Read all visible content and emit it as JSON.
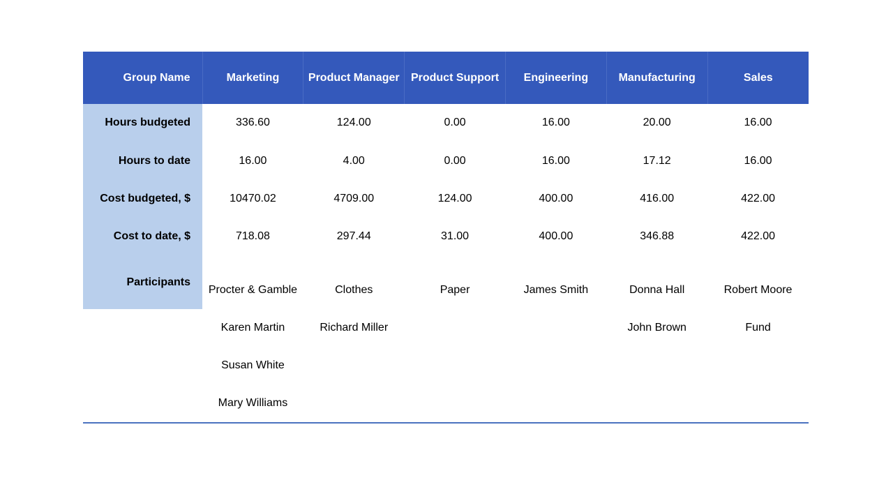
{
  "table": {
    "header": {
      "label": "Group Name",
      "columns": [
        "Marketing",
        "Product Manager",
        "Product Support",
        "Engineering",
        "Manufacturing",
        "Sales"
      ]
    },
    "rows": [
      {
        "label": "Hours budgeted",
        "values": [
          "336.60",
          "124.00",
          "0.00",
          "16.00",
          "20.00",
          "16.00"
        ]
      },
      {
        "label": "Hours to date",
        "values": [
          "16.00",
          "4.00",
          "0.00",
          "16.00",
          "17.12",
          "16.00"
        ]
      },
      {
        "label": "Cost budgeted, $",
        "values": [
          "10470.02",
          "4709.00",
          "124.00",
          "400.00",
          "416.00",
          "422.00"
        ]
      },
      {
        "label": "Cost to date, $",
        "values": [
          "718.08",
          "297.44",
          "31.00",
          "400.00",
          "346.88",
          "422.00"
        ]
      }
    ],
    "participants": {
      "label": "Participants",
      "rows": [
        [
          "Procter & Gamble",
          "Clothes",
          "Paper",
          "James Smith",
          "Donna Hall",
          "Robert Moore"
        ],
        [
          "Karen Martin",
          "Richard Miller",
          "",
          "",
          "John Brown",
          "Fund"
        ],
        [
          "Susan White",
          "",
          "",
          "",
          "",
          ""
        ],
        [
          "Mary Williams",
          "",
          "",
          "",
          "",
          ""
        ]
      ]
    }
  },
  "colors": {
    "header_bg": "#3459bb",
    "label_bg": "#b9cfec",
    "bottom_rule": "#4a72c0"
  }
}
